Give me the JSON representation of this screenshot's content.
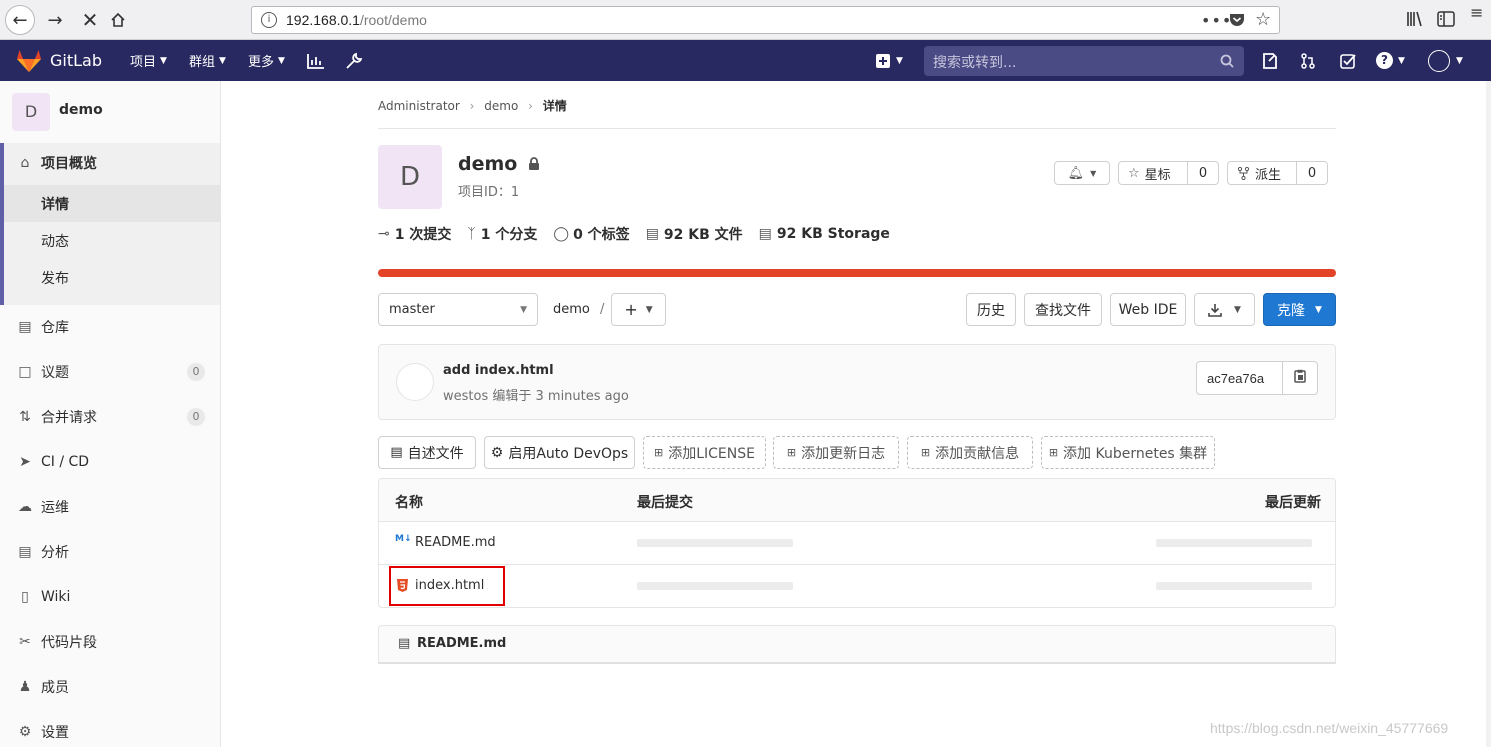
{
  "browser": {
    "url_host": "192.168.0.1",
    "url_path": "/root/demo"
  },
  "nav": {
    "logo_text": "GitLab",
    "menu_projects": "项目",
    "menu_groups": "群组",
    "menu_more": "更多",
    "search_placeholder": "搜索或转到..."
  },
  "sidebar": {
    "project_avatar": "D",
    "project_name": "demo",
    "overview": "项目概览",
    "sub_details": "详情",
    "sub_activity": "动态",
    "sub_releases": "发布",
    "repository": "仓库",
    "issues": "议题",
    "issues_count": "0",
    "merge_requests": "合并请求",
    "mr_count": "0",
    "cicd": "CI / CD",
    "operations": "运维",
    "analytics": "分析",
    "wiki": "Wiki",
    "snippets": "代码片段",
    "members": "成员",
    "settings": "设置"
  },
  "breadcrumb": {
    "root": "Administrator",
    "project": "demo",
    "current": "详情"
  },
  "project": {
    "avatar": "D",
    "name": "demo",
    "id_label": "项目ID：1",
    "star_label": "星标",
    "star_count": "0",
    "fork_label": "派生",
    "fork_count": "0"
  },
  "stats": {
    "commits": "1 次提交",
    "branches": "1 个分支",
    "tags": "0 个标签",
    "files": "92 KB 文件",
    "storage": "92 KB Storage"
  },
  "toolbar": {
    "branch": "master",
    "path": "demo",
    "path_sep": "/",
    "history": "历史",
    "find_file": "查找文件",
    "web_ide": "Web IDE",
    "clone": "克隆"
  },
  "commit": {
    "title": "add index.html",
    "author": "westos",
    "meta": "编辑于 3 minutes ago",
    "sha": "ac7ea76a"
  },
  "actions": {
    "readme": "自述文件",
    "auto_devops": "启用Auto DevOps",
    "license": "添加LICENSE",
    "changelog": "添加更新日志",
    "contributing": "添加贡献信息",
    "kubernetes": "添加 Kubernetes 集群"
  },
  "table": {
    "col_name": "名称",
    "col_commit": "最后提交",
    "col_updated": "最后更新",
    "rows": [
      {
        "name": "README.md"
      },
      {
        "name": "index.html"
      }
    ]
  },
  "readme_panel": {
    "title": "README.md"
  },
  "watermark": "https://blog.csdn.net/weixin_45777669",
  "colors": {
    "nav_bg": "#292961",
    "accent": "#1f78d1",
    "progress": "#e24329",
    "highlight_box": "#e00000"
  }
}
